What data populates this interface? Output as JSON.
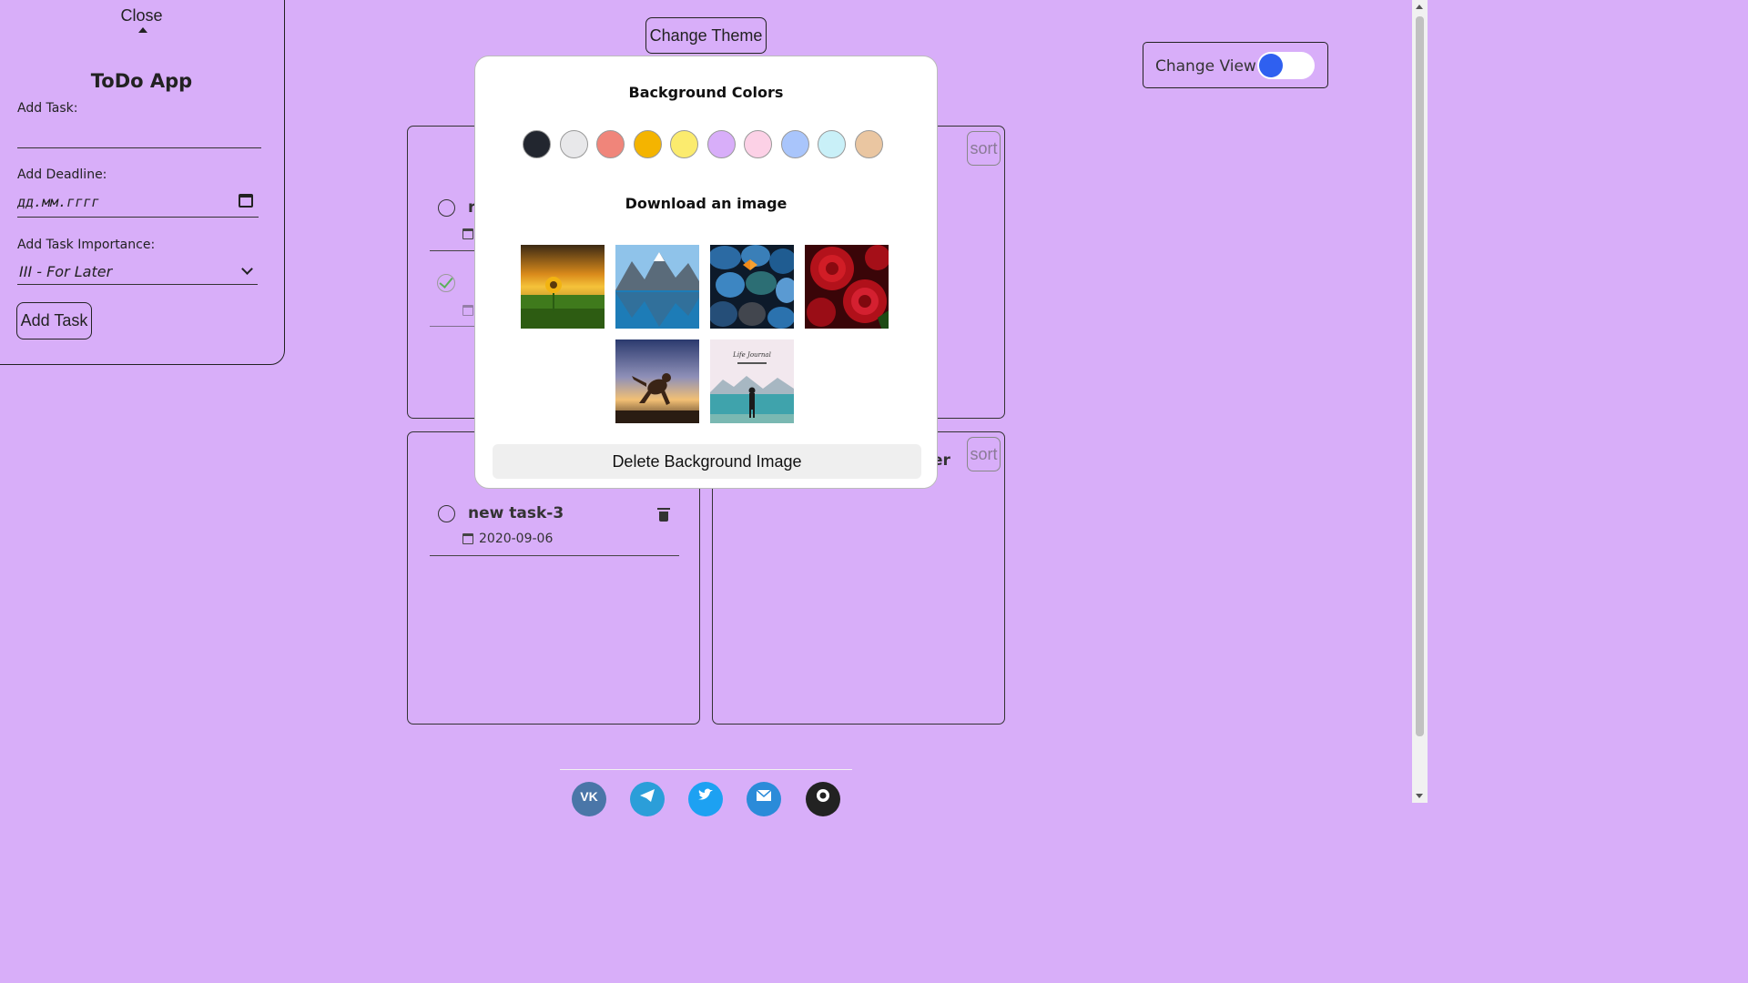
{
  "sidebar": {
    "close_label": "Close",
    "title": "ToDo App",
    "add_task_label": "Add Task:",
    "add_deadline_label": "Add Deadline:",
    "deadline_placeholder": "дд.мм.гггг",
    "importance_label": "Add Task Importance:",
    "importance_value": "III - For Later",
    "add_task_button": "Add Task"
  },
  "header": {
    "change_theme": "Change Theme",
    "change_view": "Change View",
    "change_view_on": false
  },
  "cards": {
    "sort_label": "sort",
    "top_left_task_partial": "r",
    "bottom_left_task": {
      "title": "new task-3",
      "date": "2020-09-06"
    },
    "bottom_right_heading_partial": "er"
  },
  "modal": {
    "bg_colors_title": "Background Colors",
    "colors": [
      "#22262f",
      "#e8e8ea",
      "#f0857a",
      "#f4b400",
      "#fbeb6e",
      "#d8aef9",
      "#fcd1e6",
      "#a9c5fb",
      "#c9f0f8",
      "#eac6a1"
    ],
    "download_title": "Download an image",
    "images": [
      "sunflower-sunset-image",
      "mountain-lake-image",
      "pebbles-butterfly-image",
      "red-roses-image",
      "cat-sunset-image",
      "lake-silhouette-image"
    ],
    "image_6_caption": "Life Journal",
    "delete_button": "Delete Background Image"
  },
  "footer": {
    "social": [
      "vk-icon",
      "telegram-icon",
      "twitter-icon",
      "email-icon",
      "github-icon"
    ],
    "social_colors": [
      "#4a76a8",
      "#2b9ed9",
      "#1da1f2",
      "#2b8bd9",
      "#222222"
    ]
  }
}
